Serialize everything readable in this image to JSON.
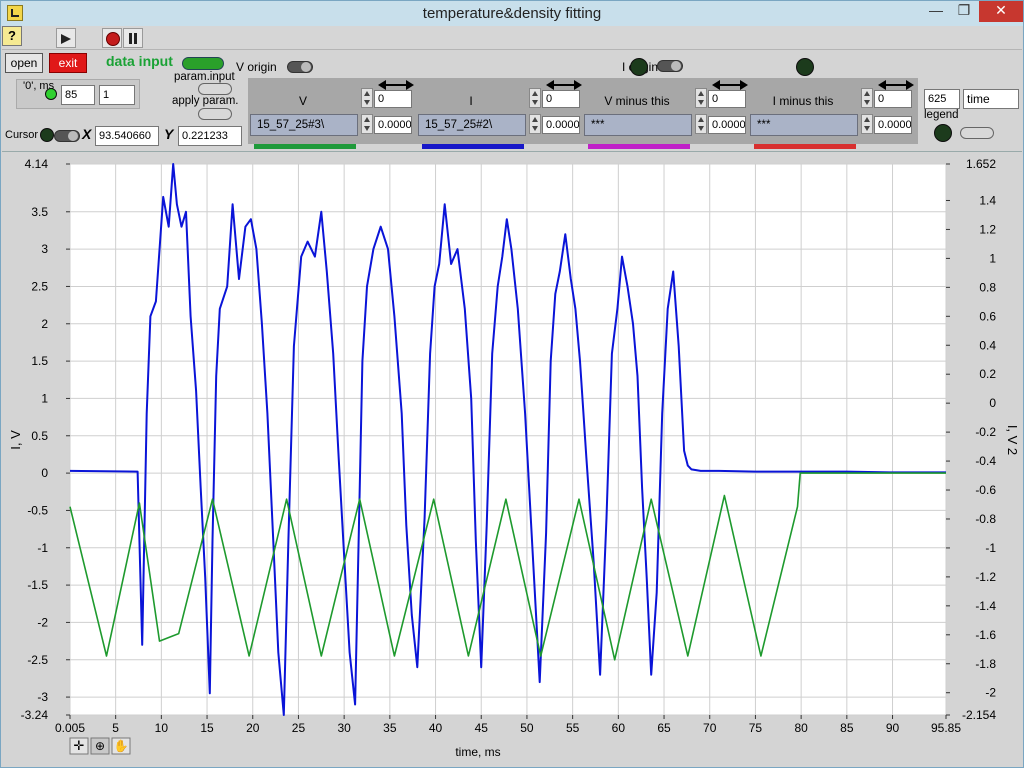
{
  "window": {
    "title": "temperature&density fitting",
    "min": "—",
    "max": "❐",
    "close": "✕"
  },
  "toolbar": {
    "help": "?"
  },
  "panel": {
    "open_label": "open",
    "exit_label": "exit",
    "data_input_label": "data input",
    "v_origin_label": "V origin",
    "i_origin_label": "I origin",
    "param_input_label": "param.input",
    "apply_param_label": "apply param.",
    "zero_ms_label": "'0', ms",
    "zero_ms_a": "85",
    "zero_ms_b": "1",
    "cursor_label": "Cursor",
    "x_label": "X",
    "x_value": "93.540660",
    "y_label": "Y",
    "y_value": "0.221233",
    "time_value": "625",
    "time_label": "time",
    "legend_label": "legend"
  },
  "signals": [
    {
      "name": "V",
      "offset": "0",
      "scale": "0.0000",
      "path": "15_57_25#3\\",
      "color": "#1f9a3a"
    },
    {
      "name": "I",
      "offset": "0",
      "scale": "0.0000",
      "path": "15_57_25#2\\",
      "color": "#1818c8"
    },
    {
      "name": "V minus this",
      "offset": "0",
      "scale": "0.0000",
      "path": "***",
      "color": "#c020c8"
    },
    {
      "name": "I minus this",
      "offset": "0",
      "scale": "0.0000",
      "path": "***",
      "color": "#d83030"
    }
  ],
  "colors": {
    "blue_series": "#0a14d8",
    "green_series": "#1e9a2e"
  },
  "chart_data": {
    "type": "line",
    "xlabel": "time, ms",
    "ylabel_left": "I, V",
    "ylabel_right": "I, V 2",
    "xlim": [
      0.005,
      95.85
    ],
    "ylim_left": [
      -3.24,
      4.14
    ],
    "ylim_right": [
      -2.154,
      1.652
    ],
    "x_ticks": [
      "0.005",
      "5",
      "10",
      "15",
      "20",
      "25",
      "30",
      "35",
      "40",
      "45",
      "50",
      "55",
      "60",
      "65",
      "70",
      "75",
      "80",
      "85",
      "90",
      "95.85"
    ],
    "y_ticks_left": [
      "4.14",
      "3.5",
      "3",
      "2.5",
      "2",
      "1.5",
      "1",
      "0.5",
      "0",
      "-0.5",
      "-1",
      "-1.5",
      "-2",
      "-2.5",
      "-3",
      "-3.24"
    ],
    "y_ticks_right": [
      "1.652",
      "1.4",
      "1.2",
      "1",
      "0.8",
      "0.6",
      "0.4",
      "0.2",
      "0",
      "-0.2",
      "-0.4",
      "-0.6",
      "-0.8",
      "-1",
      "-1.2",
      "-1.4",
      "-1.6",
      "-1.8",
      "-2",
      "-2.154"
    ],
    "grid": true,
    "series": [
      {
        "color": "#0a14d8",
        "axis": "left",
        "x": [
          0.005,
          7.4,
          7.9,
          8.4,
          8.8,
          9.4,
          10.2,
          10.8,
          11.3,
          11.7,
          12.2,
          12.7,
          13.2,
          13.8,
          14.3,
          14.8,
          15.3,
          15.6,
          16.0,
          16.4,
          17.2,
          17.8,
          18.5,
          19.2,
          19.8,
          20.4,
          21.0,
          21.6,
          22.2,
          22.8,
          23.4,
          23.9,
          24.5,
          25.3,
          26.0,
          26.8,
          27.5,
          28.1,
          28.8,
          29.4,
          30.0,
          30.6,
          31.2,
          31.6,
          32.0,
          32.5,
          33.2,
          34.0,
          34.8,
          35.5,
          36.3,
          36.8,
          37.4,
          38.0,
          38.8,
          39.4,
          39.9,
          40.4,
          41.0,
          41.7,
          42.4,
          43.2,
          43.9,
          44.4,
          45.0,
          45.6,
          46.2,
          46.8,
          47.3,
          47.8,
          48.3,
          49.0,
          49.8,
          50.6,
          51.4,
          52.1,
          52.6,
          53.1,
          53.6,
          54.2,
          54.8,
          55.3,
          55.8,
          56.5,
          57.3,
          58.0,
          58.7,
          59.3,
          59.9,
          60.4,
          61.0,
          61.6,
          62.1,
          62.6,
          63.1,
          63.6,
          64.2,
          64.8,
          65.4,
          66.0,
          66.6,
          67.2,
          67.6,
          68.0,
          69.0,
          71.0,
          75.0,
          80.0,
          85.0,
          90.0,
          95.85
        ],
        "y": [
          0.03,
          0.02,
          -2.3,
          0.8,
          2.1,
          2.3,
          3.7,
          3.3,
          4.14,
          3.6,
          3.3,
          3.5,
          2.1,
          1.1,
          -0.2,
          -1.4,
          -2.95,
          -0.9,
          1.3,
          2.2,
          2.5,
          3.6,
          2.6,
          3.3,
          3.4,
          3.0,
          2.0,
          0.8,
          -0.8,
          -2.4,
          -3.24,
          -0.9,
          1.7,
          2.9,
          3.1,
          2.9,
          3.5,
          2.7,
          1.6,
          0.2,
          -1.1,
          -2.4,
          -3.1,
          -0.8,
          1.5,
          2.5,
          3.0,
          3.3,
          3.0,
          2.1,
          0.8,
          -0.7,
          -1.9,
          -2.6,
          -0.6,
          1.6,
          2.5,
          2.8,
          3.6,
          2.8,
          3.0,
          2.2,
          1.0,
          -0.9,
          -2.6,
          -0.7,
          1.6,
          2.5,
          2.9,
          3.4,
          3.0,
          2.2,
          0.8,
          -1.0,
          -2.8,
          -0.8,
          1.5,
          2.4,
          2.7,
          3.2,
          2.6,
          2.2,
          1.5,
          0.2,
          -1.2,
          -2.7,
          -0.6,
          1.6,
          2.2,
          2.9,
          2.5,
          2.0,
          1.3,
          -0.2,
          -1.4,
          -2.7,
          -1.6,
          0.8,
          2.2,
          2.7,
          1.7,
          0.3,
          0.1,
          0.05,
          0.03,
          0.03,
          0.02,
          0.02,
          0.02,
          0.01,
          0.01
        ]
      },
      {
        "color": "#1e9a2e",
        "axis": "left",
        "x": [
          0.005,
          4.0,
          7.6,
          9.8,
          11.9,
          15.6,
          19.6,
          23.7,
          27.5,
          31.7,
          35.5,
          39.8,
          43.6,
          47.7,
          51.5,
          55.7,
          59.6,
          63.6,
          67.6,
          71.6,
          75.6,
          79.6,
          79.9,
          85.0,
          90.0,
          95.85
        ],
        "y": [
          -0.45,
          -2.45,
          -0.4,
          -2.25,
          -2.15,
          -0.35,
          -2.45,
          -0.35,
          -2.45,
          -0.35,
          -2.45,
          -0.35,
          -2.45,
          -0.35,
          -2.45,
          -0.35,
          -2.5,
          -0.35,
          -2.45,
          -0.3,
          -2.45,
          -0.45,
          0.0,
          0.0,
          0.0,
          0.0
        ]
      }
    ]
  }
}
